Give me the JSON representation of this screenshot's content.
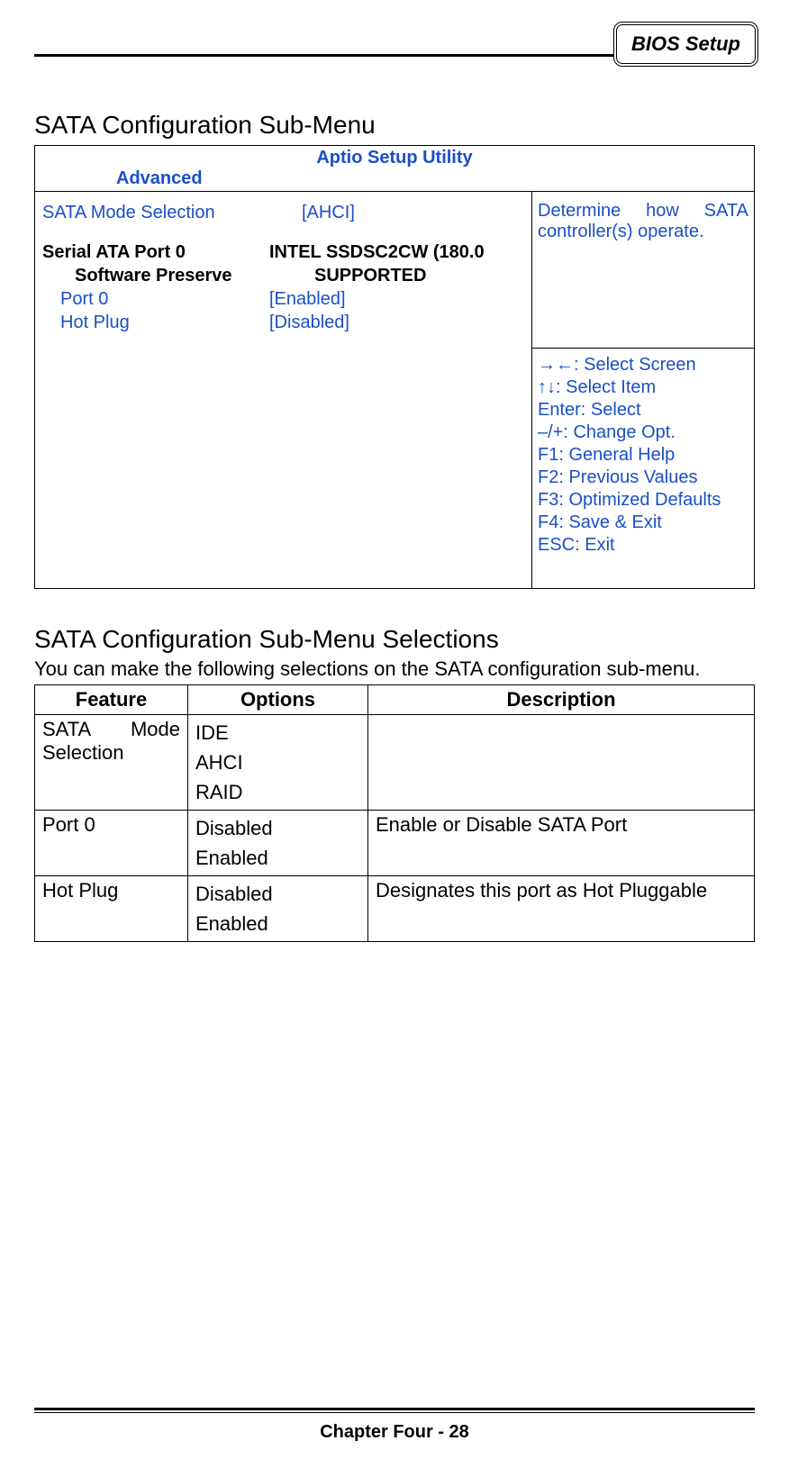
{
  "badge": "BIOS Setup",
  "section1_title": "SATA Configuration Sub-Menu",
  "bios": {
    "utility_title": "Aptio Setup Utility",
    "tab": "Advanced",
    "items": {
      "sata_mode_label": "SATA Mode Selection",
      "sata_mode_value": "[AHCI]",
      "port_header_label": "Serial ATA Port 0",
      "port_header_value": "INTEL SSDSC2CW (180.0",
      "sw_preserve_label": "Software Preserve",
      "sw_preserve_value": "SUPPORTED",
      "port0_label": "Port 0",
      "port0_value": "[Enabled]",
      "hotplug_label": "Hot Plug",
      "hotplug_value": "[Disabled]"
    },
    "help_desc": "Determine how SATA controller(s) operate.",
    "keys": {
      "l1": "→←: Select Screen",
      "l2": "↑↓: Select Item",
      "l3": "Enter: Select",
      "l4": "–/+: Change Opt.",
      "l5": "F1: General Help",
      "l6": "F2: Previous Values",
      "l7": "F3: Optimized Defaults",
      "l8": "F4: Save & Exit",
      "l9": "ESC: Exit"
    }
  },
  "section2_title": "SATA Configuration Sub-Menu Selections",
  "intro_text": "You can make the following selections on the SATA configuration sub-menu.",
  "table": {
    "headers": {
      "feature": "Feature",
      "options": "Options",
      "description": "Description"
    },
    "rows": [
      {
        "feature": "SATA Mode Selection",
        "options": [
          "IDE",
          "AHCI",
          "RAID"
        ],
        "description": ""
      },
      {
        "feature": "Port 0",
        "options": [
          "Disabled",
          "Enabled"
        ],
        "description": "Enable or Disable SATA Port"
      },
      {
        "feature": "Hot Plug",
        "options": [
          "Disabled",
          "Enabled"
        ],
        "description": "Designates this port as Hot Pluggable"
      }
    ]
  },
  "footer": "Chapter Four - 28"
}
